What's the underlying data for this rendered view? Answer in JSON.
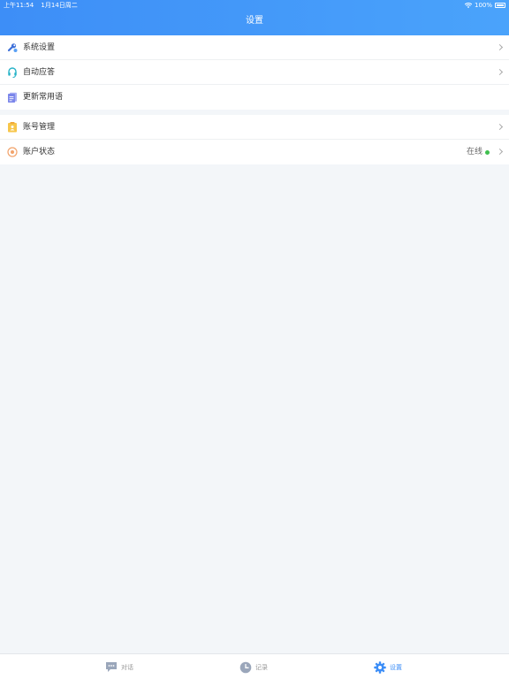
{
  "status_bar": {
    "time": "上午11:54",
    "date": "1月14日周二",
    "battery": "100%"
  },
  "header": {
    "title": "设置"
  },
  "groups": [
    {
      "items": [
        {
          "label": "系统设置",
          "icon": "wrench-icon"
        },
        {
          "label": "自动应答",
          "icon": "headset-icon"
        },
        {
          "label": "更新常用语",
          "icon": "document-icon"
        }
      ]
    },
    {
      "items": [
        {
          "label": "账号管理",
          "icon": "id-card-icon"
        },
        {
          "label": "账户状态",
          "icon": "status-circle-icon",
          "status": "在线"
        }
      ]
    }
  ],
  "tabbar": {
    "tabs": [
      {
        "label": "对话",
        "icon": "chat-icon"
      },
      {
        "label": "记录",
        "icon": "clock-icon"
      },
      {
        "label": "设置",
        "icon": "gear-icon",
        "active": true
      }
    ]
  },
  "colors": {
    "accent": "#3d8ef7",
    "online": "#3fbf4f",
    "background": "#f3f6f9"
  }
}
